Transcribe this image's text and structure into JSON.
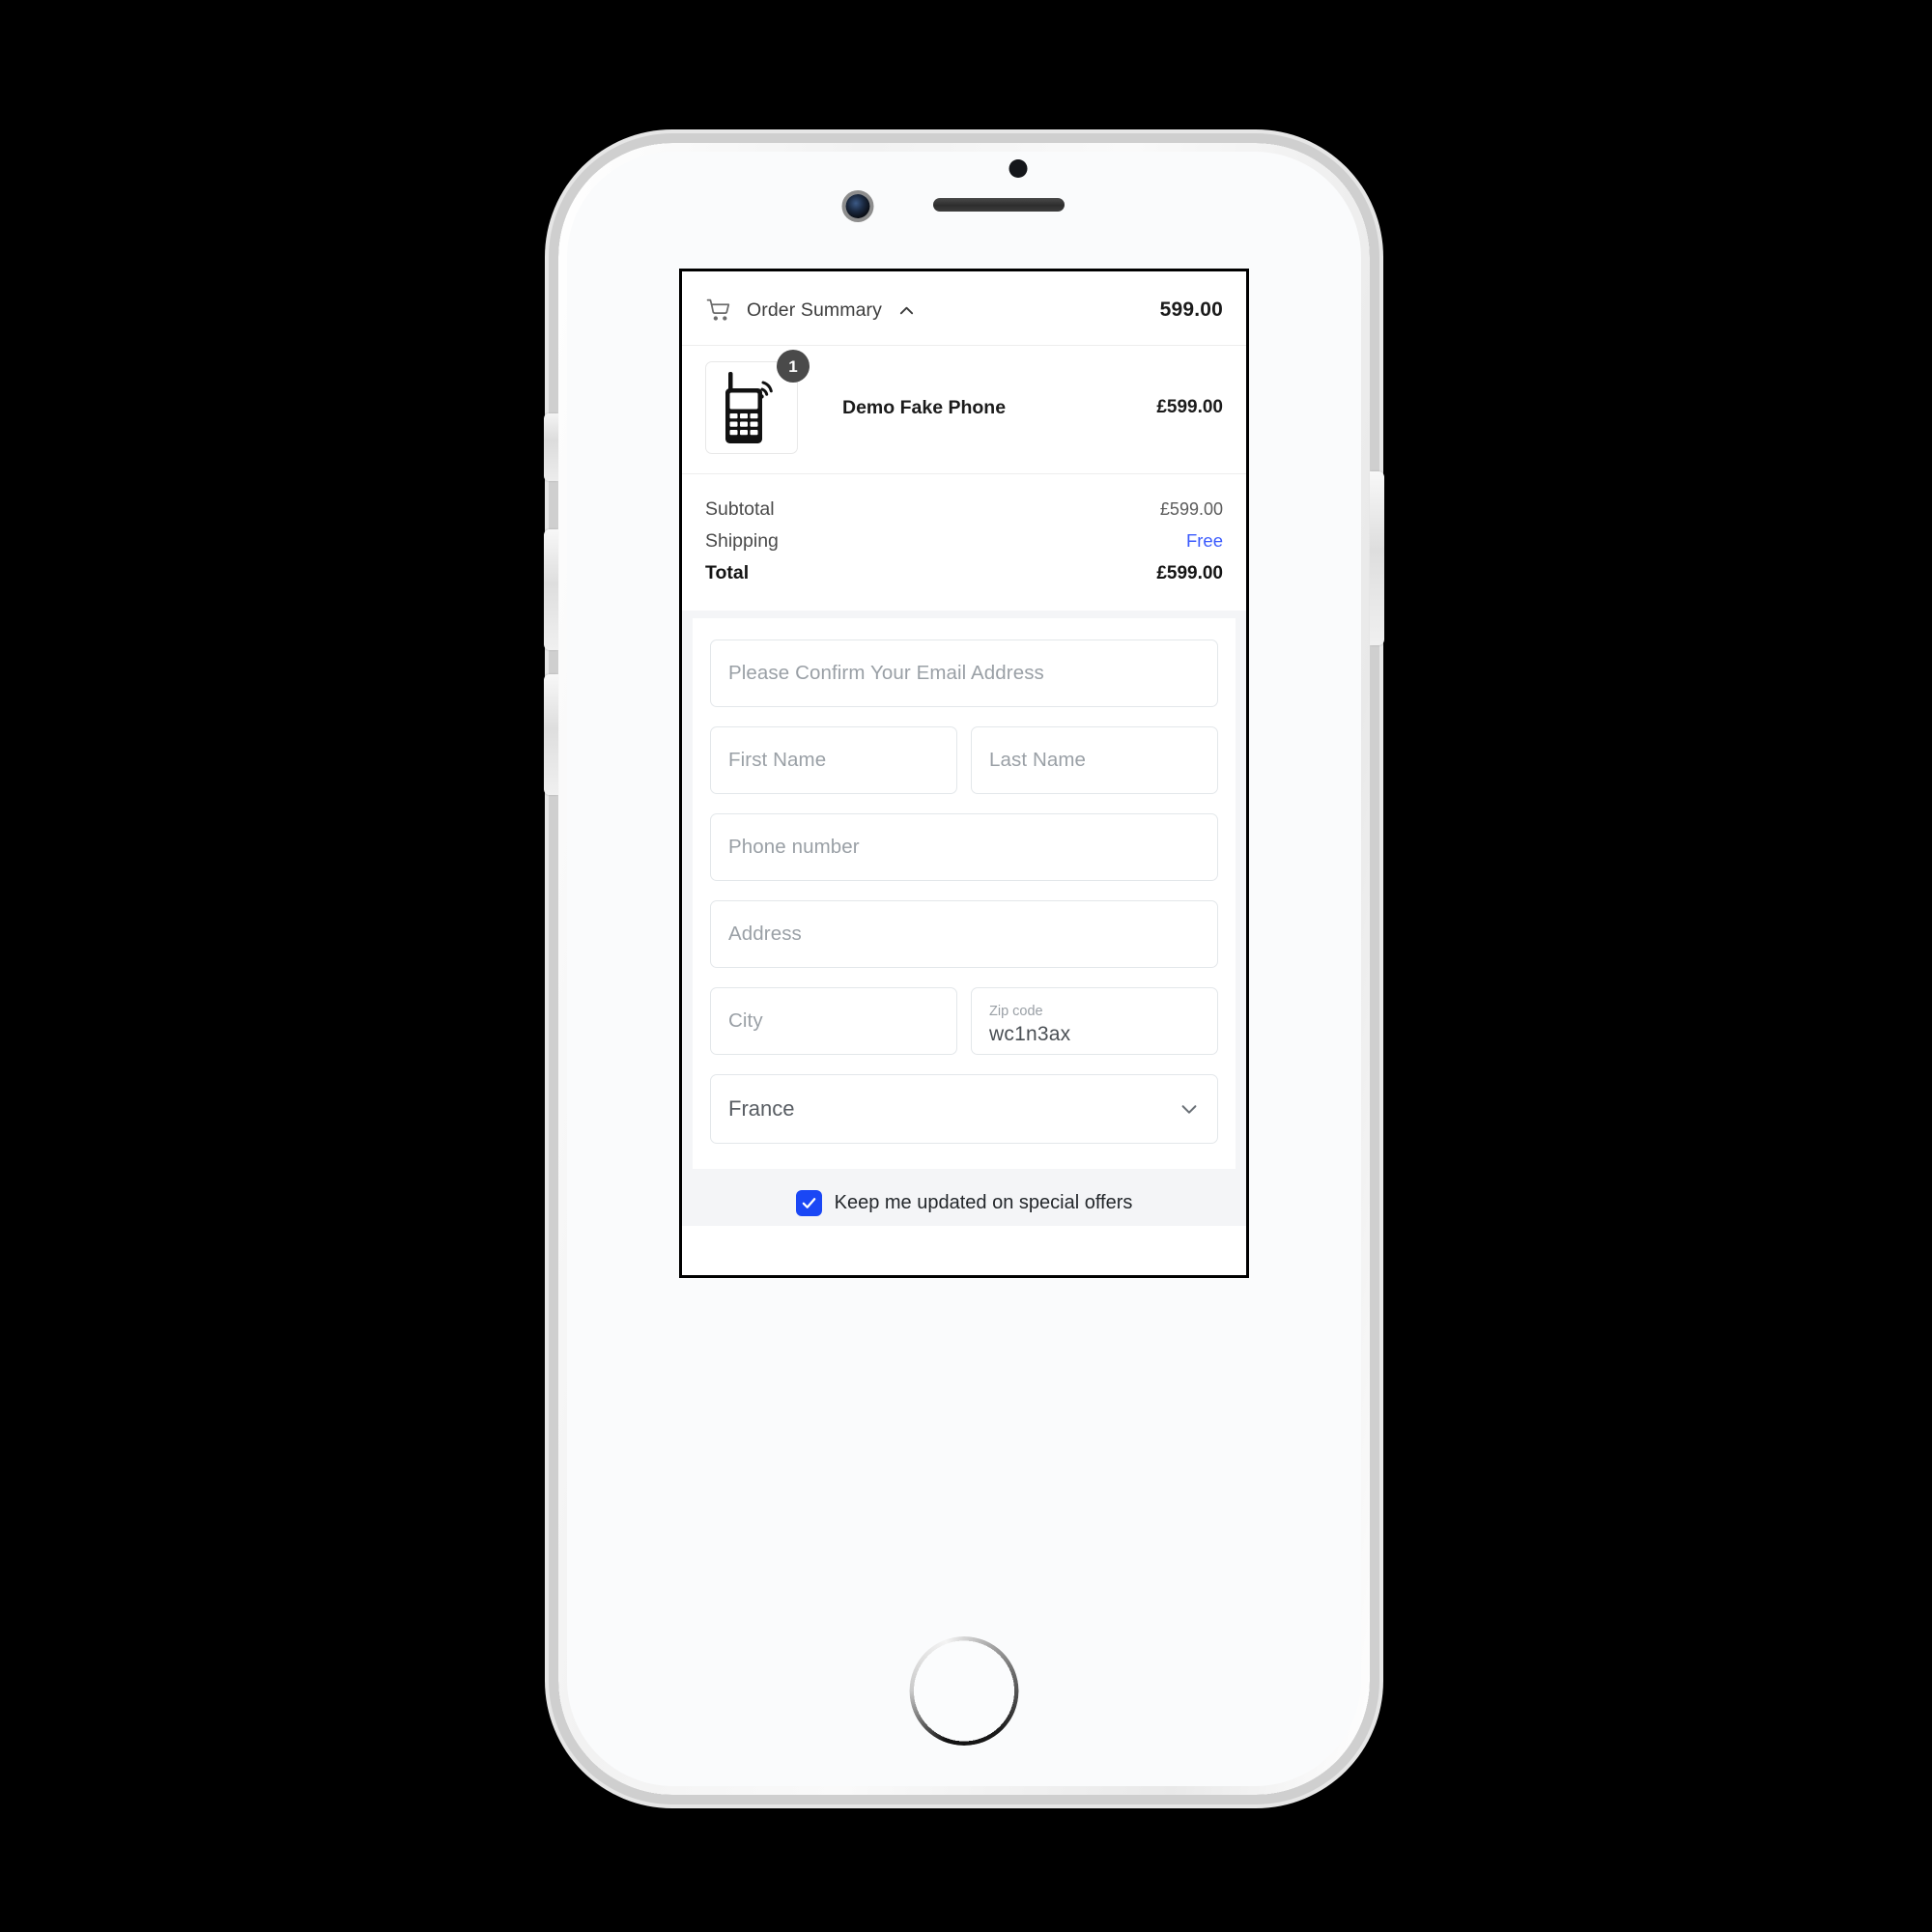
{
  "order_summary": {
    "cart_icon": "shopping-cart-icon",
    "title": "Order Summary",
    "toggle_icon": "chevron-up-icon",
    "header_amount": "599.00",
    "items": [
      {
        "image_icon": "mobile-phone-icon",
        "quantity_badge": "1",
        "name": "Demo Fake Phone",
        "price": "£599.00"
      }
    ],
    "totals": [
      {
        "label": "Subtotal",
        "value": "£599.00",
        "style": "normal"
      },
      {
        "label": "Shipping",
        "value": "Free",
        "style": "free"
      },
      {
        "label": "Total",
        "value": "£599.00",
        "style": "grand"
      }
    ]
  },
  "checkout_form": {
    "email": {
      "placeholder": "Please Confirm Your Email Address",
      "value": ""
    },
    "first_name": {
      "placeholder": "First Name",
      "value": ""
    },
    "last_name": {
      "placeholder": "Last Name",
      "value": ""
    },
    "phone": {
      "placeholder": "Phone number",
      "value": ""
    },
    "address": {
      "placeholder": "Address",
      "value": ""
    },
    "city": {
      "placeholder": "City",
      "value": ""
    },
    "zip": {
      "label": "Zip code",
      "value": "wc1n3ax"
    },
    "country": {
      "selected": "France",
      "dropdown_icon": "chevron-down-icon"
    }
  },
  "offers": {
    "checked": true,
    "check_icon": "checkmark-icon",
    "label": "Keep me updated on special offers"
  },
  "device": {
    "earpiece": "earpiece-speaker",
    "front_camera": "front-camera",
    "sensor": "proximity-sensor",
    "home_button": "home-button",
    "silent_switch": "silent-switch",
    "volume_up": "volume-up-button",
    "volume_down": "volume-down-button",
    "power": "power-button"
  },
  "colors": {
    "accent_blue": "#3b5bfd",
    "checkbox_blue": "#1a47f5",
    "text_dark": "#1b1b1b",
    "text_muted": "#9aa0a6",
    "field_border": "#e3e7ea",
    "page_bg": "#f4f5f7"
  }
}
